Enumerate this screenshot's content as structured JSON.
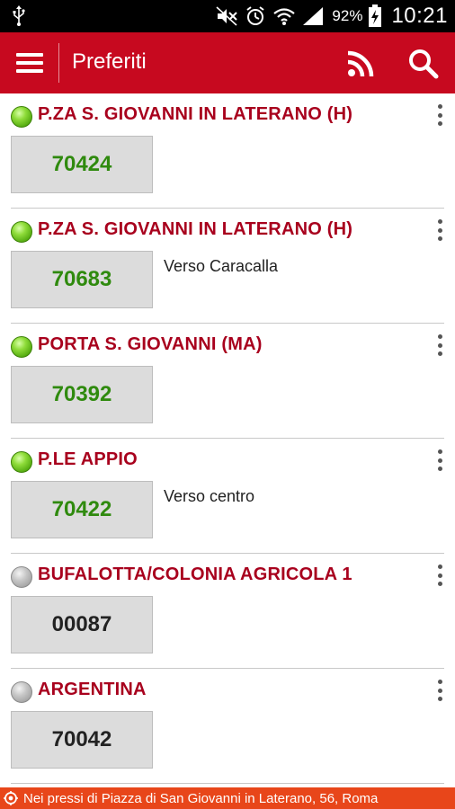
{
  "status_bar": {
    "battery_percent": "92%",
    "time": "10:21",
    "icons": [
      "usb-icon",
      "mute-icon",
      "alarm-icon",
      "wifi-icon",
      "signal-icon",
      "battery-charging-icon"
    ]
  },
  "action_bar": {
    "title": "Preferiti",
    "color": "#c7091f",
    "icons": [
      "menu-icon",
      "rss-icon",
      "search-icon"
    ]
  },
  "favorites": [
    {
      "name": "P.ZA S. GIOVANNI IN LATERANO (H)",
      "code": "70424",
      "direction": "",
      "active": true
    },
    {
      "name": "P.ZA S. GIOVANNI IN LATERANO (H)",
      "code": "70683",
      "direction": "Verso Caracalla",
      "active": true
    },
    {
      "name": "PORTA S. GIOVANNI (MA)",
      "code": "70392",
      "direction": "",
      "active": true
    },
    {
      "name": "P.LE APPIO",
      "code": "70422",
      "direction": "Verso centro",
      "active": true
    },
    {
      "name": "BUFALOTTA/COLONIA AGRICOLA 1",
      "code": "00087",
      "direction": "",
      "active": false
    },
    {
      "name": "ARGENTINA",
      "code": "70042",
      "direction": "",
      "active": false
    }
  ],
  "location_bar": {
    "text": "Nei pressi di Piazza di San Giovanni in Laterano, 56, Roma",
    "icon": "location-pin-icon",
    "color": "#e8461a"
  },
  "colors": {
    "stop_name": "#a8001d",
    "active_code": "#2f8a0e",
    "inactive_code": "#222222"
  }
}
